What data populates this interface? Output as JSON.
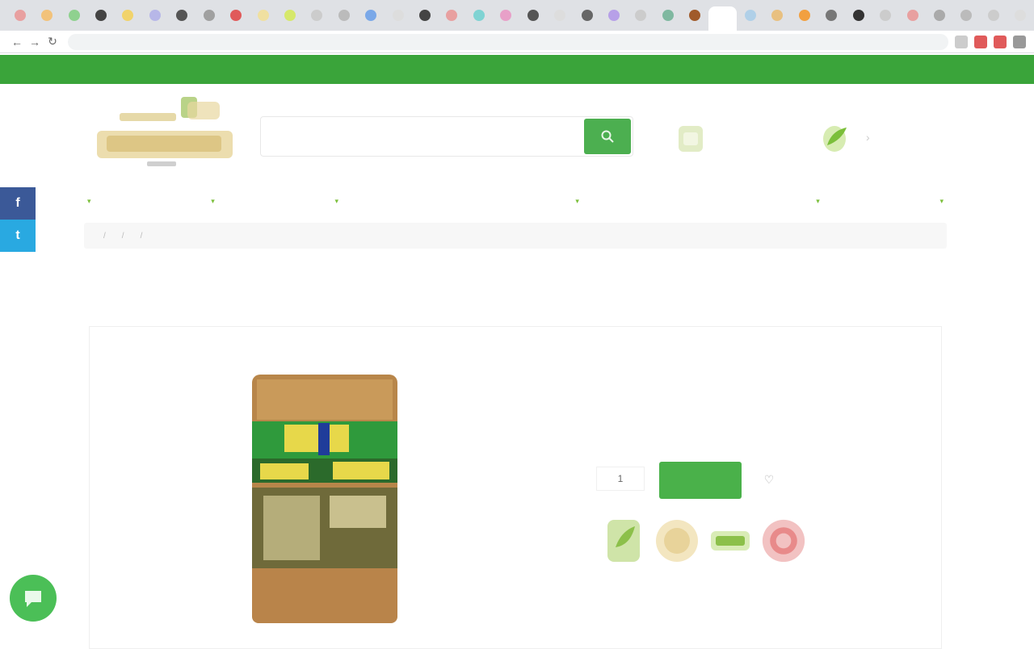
{
  "browser": {
    "tab_colors": [
      "#e8a0a0",
      "#f2c27a",
      "#8fd18f",
      "#444444",
      "#f1d36b",
      "#b7b7e8",
      "#555555",
      "#a0a0a0",
      "#e05a5a",
      "#f0e0a0",
      "#d6e86b",
      "#cccccc",
      "#bbbbbb",
      "#7aa8e8",
      "#dddddd",
      "#444444",
      "#e8a0a0",
      "#7fd3d3",
      "#e8a0c8",
      "#555555",
      "#dddddd",
      "#666666",
      "#b7a0e8",
      "#cccccc",
      "#7fb8a0",
      "#a05a2a",
      "#ffffff",
      "#b0d0e8",
      "#e8c080",
      "#f2a040",
      "#777777",
      "#333333",
      "#cccccc",
      "#e8a0a0",
      "#aaaaaa",
      "#bbbbbb",
      "#cccccc",
      "#dddddd"
    ],
    "url": "",
    "extension_colors": [
      "#cccccc",
      "#e05a5a",
      "#e05a5a",
      "#999999"
    ]
  },
  "topbar": {
    "items": [
      "",
      "",
      "",
      ""
    ]
  },
  "header": {
    "search_placeholder": "",
    "delivery_text": "",
    "phone": "",
    "cart_text": ""
  },
  "nav": {
    "items": [
      {
        "label": "",
        "has_dropdown": true
      },
      {
        "label": "",
        "has_dropdown": true
      },
      {
        "label": "",
        "has_dropdown": true
      },
      {
        "label": "",
        "has_dropdown": false
      },
      {
        "label": "",
        "has_dropdown": true
      },
      {
        "label": "",
        "has_dropdown": false
      },
      {
        "label": "",
        "has_dropdown": true
      },
      {
        "label": "",
        "has_dropdown": true
      }
    ]
  },
  "breadcrumb": [
    "",
    "",
    "",
    ""
  ],
  "product": {
    "title": "",
    "availability_label": "",
    "availability_value": "",
    "price": "",
    "shipping_title": "",
    "shipping_note": "",
    "quantity": "1",
    "buy_label": "",
    "description_1": "",
    "description_2": ""
  },
  "colors": {
    "brand_green": "#3aa43a",
    "button_green": "#4ab14a",
    "title_green": "#2f7d2f"
  }
}
